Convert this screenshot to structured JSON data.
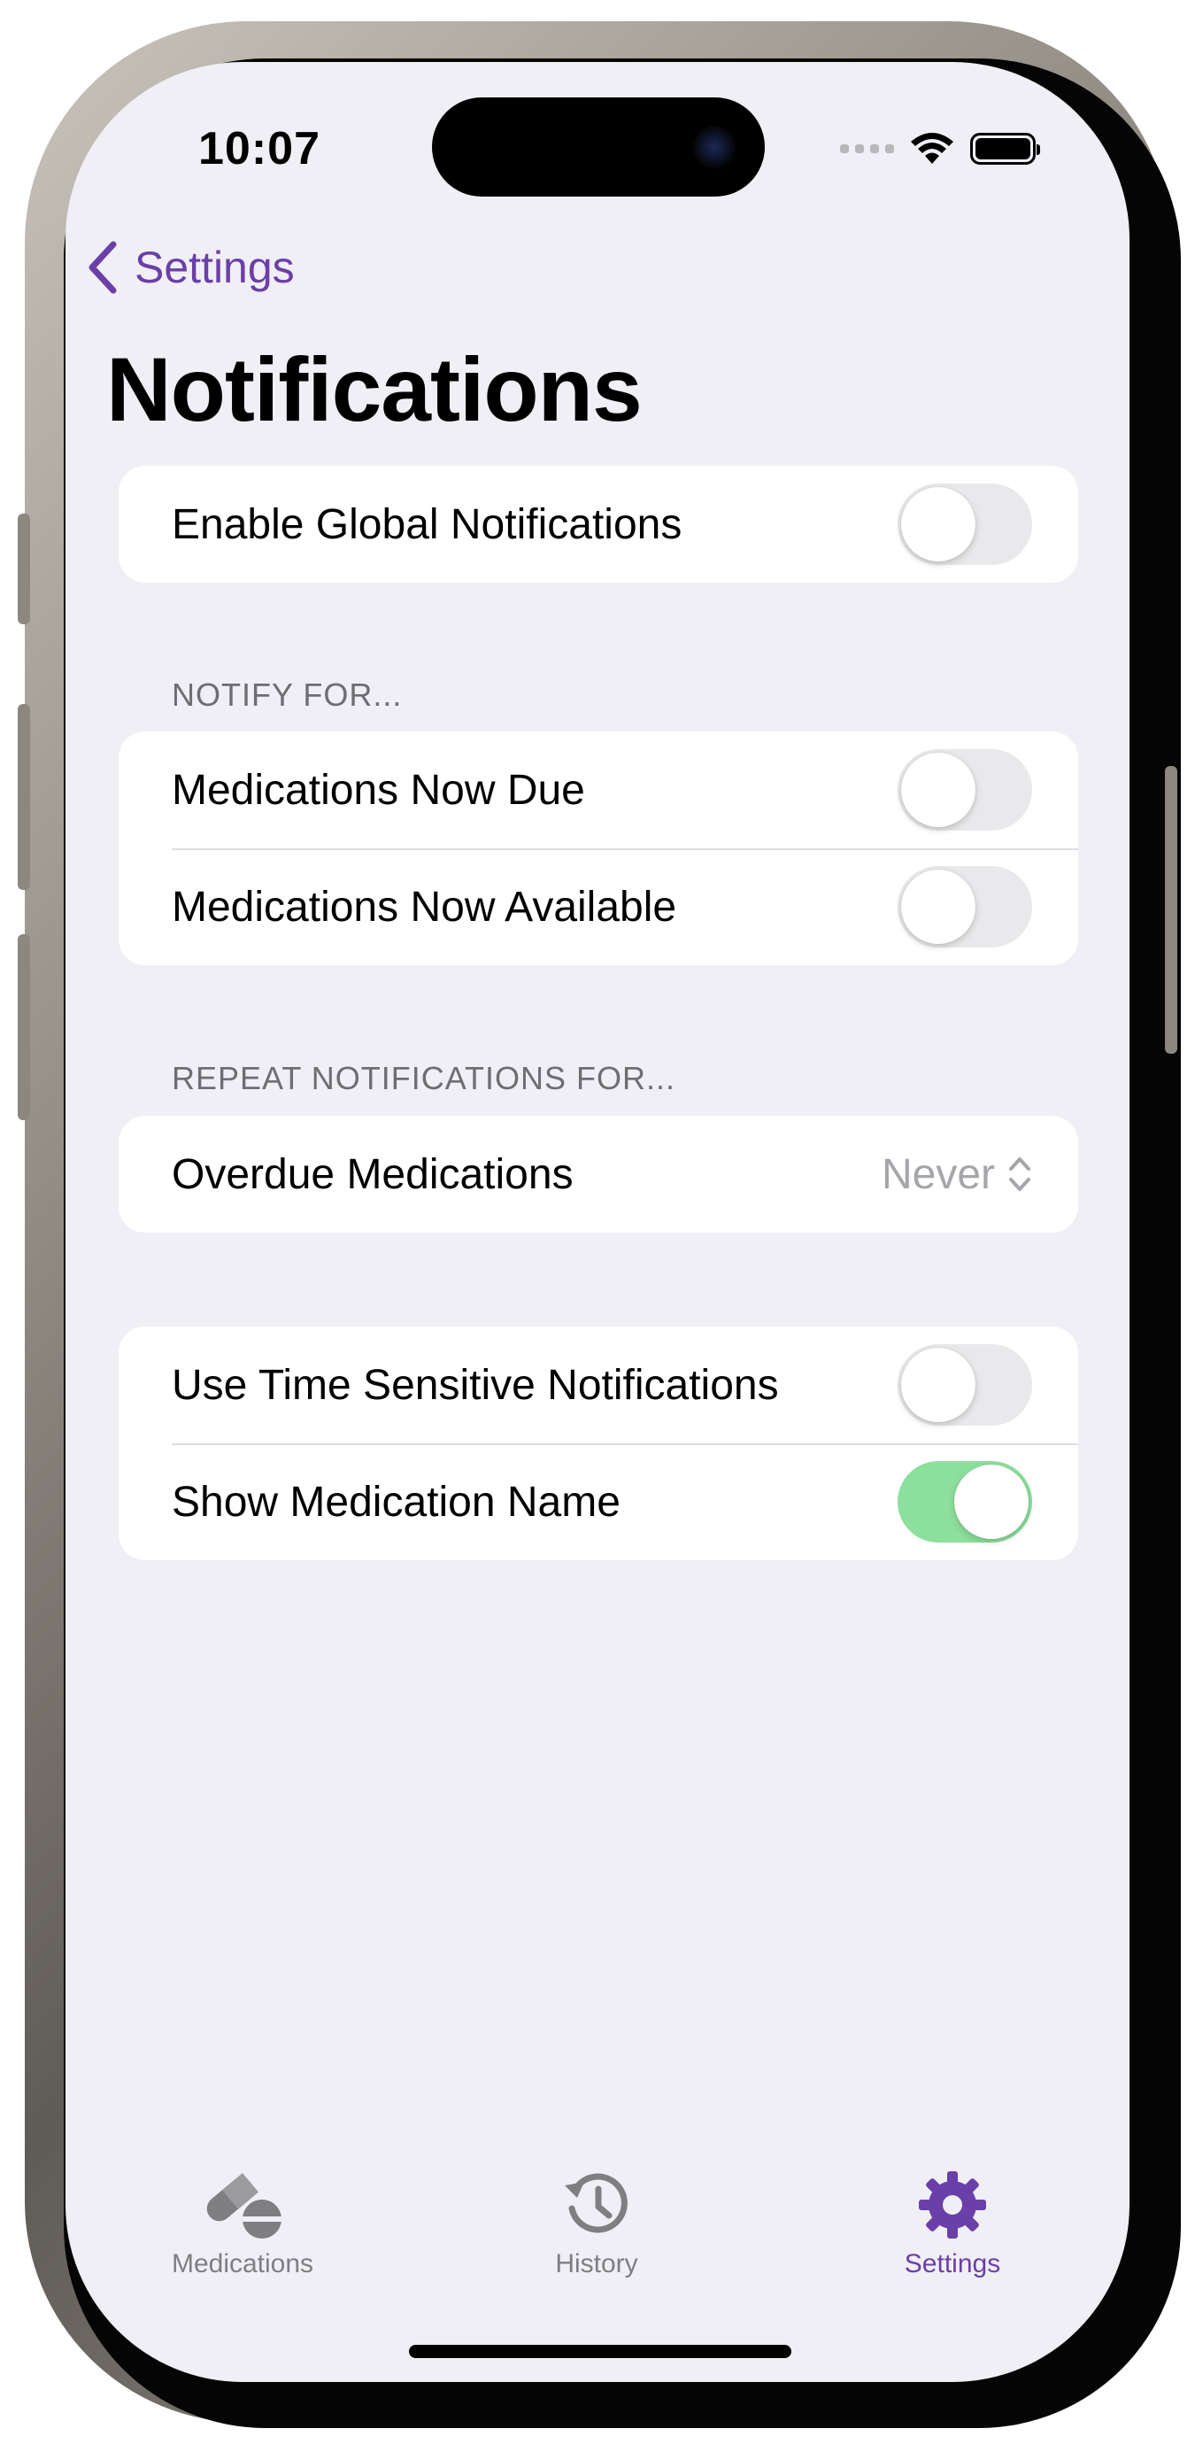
{
  "status_bar": {
    "time": "10:07"
  },
  "navigation": {
    "back_label": "Settings",
    "title": "Notifications"
  },
  "global": {
    "label": "Enable Global Notifications",
    "enabled": false
  },
  "notify_for": {
    "header": "NOTIFY FOR...",
    "items": [
      {
        "label": "Medications Now Due",
        "enabled": false
      },
      {
        "label": "Medications Now Available",
        "enabled": false
      }
    ]
  },
  "repeat_notifications": {
    "header": "REPEAT NOTIFICATIONS FOR...",
    "label": "Overdue Medications",
    "value": "Never"
  },
  "options": {
    "items": [
      {
        "label": "Use Time Sensitive Notifications",
        "enabled": false
      },
      {
        "label": "Show Medication Name",
        "enabled": true
      }
    ]
  },
  "tab_bar": {
    "active": "settings",
    "tabs": [
      {
        "id": "medications",
        "label": "Medications",
        "icon": "pills-icon"
      },
      {
        "id": "history",
        "label": "History",
        "icon": "history-clock-icon"
      },
      {
        "id": "settings",
        "label": "Settings",
        "icon": "gear-icon"
      }
    ]
  },
  "colors": {
    "accent": "#6b3fa8",
    "toggle_on": "#8ddf9c",
    "toggle_off": "#e9e9eb",
    "background": "#f0eff5"
  }
}
